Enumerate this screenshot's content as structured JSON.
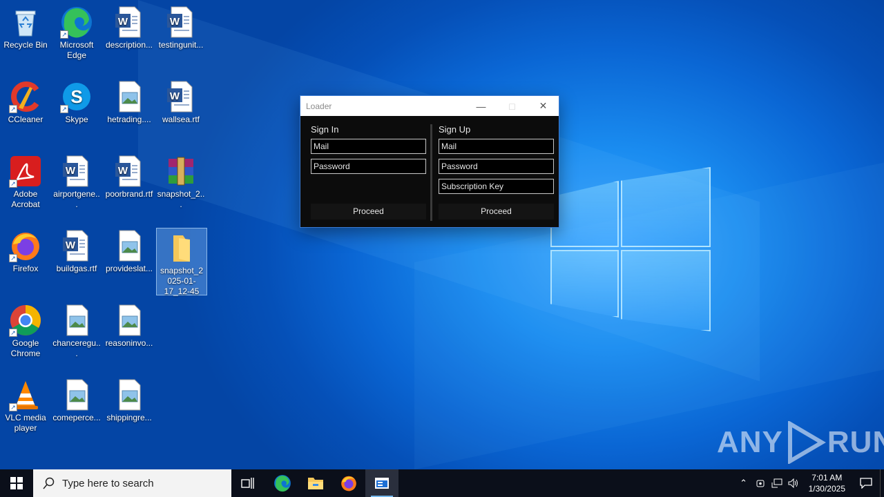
{
  "desktop": {
    "icons": [
      {
        "label": "Recycle Bin",
        "type": "recycle-bin-icon"
      },
      {
        "label": "Microsoft Edge",
        "type": "edge-icon"
      },
      {
        "label": "description...",
        "type": "word-doc-icon"
      },
      {
        "label": "testingunit...",
        "type": "word-doc-icon"
      },
      {
        "label": "CCleaner",
        "type": "ccleaner-icon"
      },
      {
        "label": "Skype",
        "type": "skype-icon"
      },
      {
        "label": "hetrading....",
        "type": "image-file-icon"
      },
      {
        "label": "wallsea.rtf",
        "type": "word-doc-icon"
      },
      {
        "label": "Adobe Acrobat",
        "type": "acrobat-icon"
      },
      {
        "label": "airportgene...",
        "type": "word-doc-icon"
      },
      {
        "label": "poorbrand.rtf",
        "type": "word-doc-icon"
      },
      {
        "label": "snapshot_2...",
        "type": "winrar-icon"
      },
      {
        "label": "Firefox",
        "type": "firefox-icon"
      },
      {
        "label": "buildgas.rtf",
        "type": "word-doc-icon"
      },
      {
        "label": "provideslat...",
        "type": "image-file-icon"
      },
      {
        "label": "snapshot_2025-01-17_12-45",
        "type": "folder-icon"
      },
      {
        "label": "Google Chrome",
        "type": "chrome-icon"
      },
      {
        "label": "chanceregu...",
        "type": "image-file-icon"
      },
      {
        "label": "reasoninvo...",
        "type": "image-file-icon"
      },
      {
        "label": "VLC media player",
        "type": "vlc-icon"
      },
      {
        "label": "comeperce...",
        "type": "image-file-icon"
      },
      {
        "label": "shippingre...",
        "type": "image-file-icon"
      }
    ]
  },
  "window": {
    "title": "Loader",
    "sign_in": {
      "heading": "Sign In",
      "mail": "Mail",
      "password": "Password",
      "button": "Proceed"
    },
    "sign_up": {
      "heading": "Sign Up",
      "mail": "Mail",
      "password": "Password",
      "subscription_key": "Subscription Key",
      "button": "Proceed"
    }
  },
  "watermark": {
    "left": "ANY",
    "right": "RUN"
  },
  "taskbar": {
    "search_placeholder": "Type here to search",
    "time": "7:01 AM",
    "date": "1/30/2025"
  }
}
